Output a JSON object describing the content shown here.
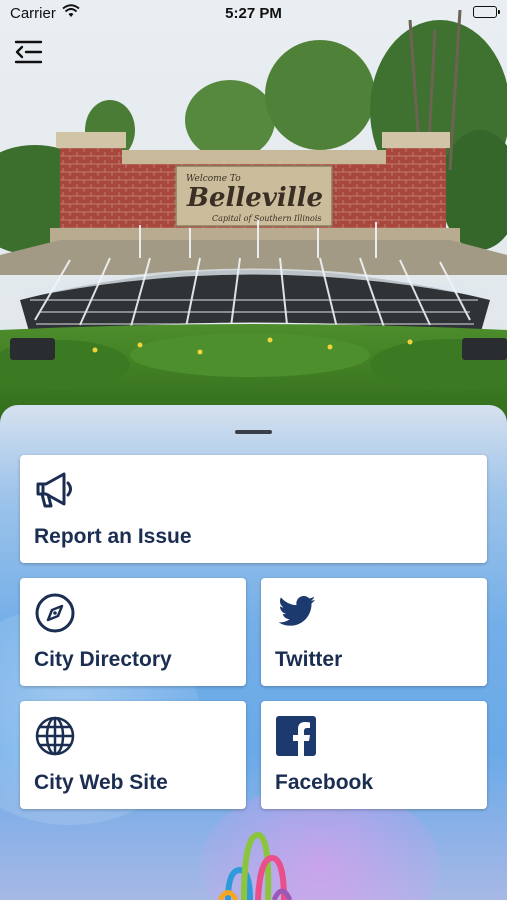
{
  "status_bar": {
    "carrier": "Carrier",
    "time": "5:27 PM"
  },
  "header": {
    "menu_icon": "menu-back-icon",
    "hero_image": "Belleville welcome sign with fountain",
    "sign_text": {
      "welcome": "Welcome To",
      "city": "Belleville",
      "tagline": "Capital of Southern Illinois"
    }
  },
  "tiles": [
    {
      "id": "report",
      "label": "Report an Issue",
      "icon": "megaphone-icon"
    },
    {
      "id": "directory",
      "label": "City Directory",
      "icon": "compass-icon"
    },
    {
      "id": "twitter",
      "label": "Twitter",
      "icon": "twitter-icon"
    },
    {
      "id": "website",
      "label": "City Web Site",
      "icon": "globe-icon"
    },
    {
      "id": "facebook",
      "label": "Facebook",
      "icon": "facebook-icon"
    }
  ],
  "colors": {
    "tile_text": "#1b2e52",
    "twitter": "#1d3a6e",
    "facebook": "#1d3a6e"
  }
}
